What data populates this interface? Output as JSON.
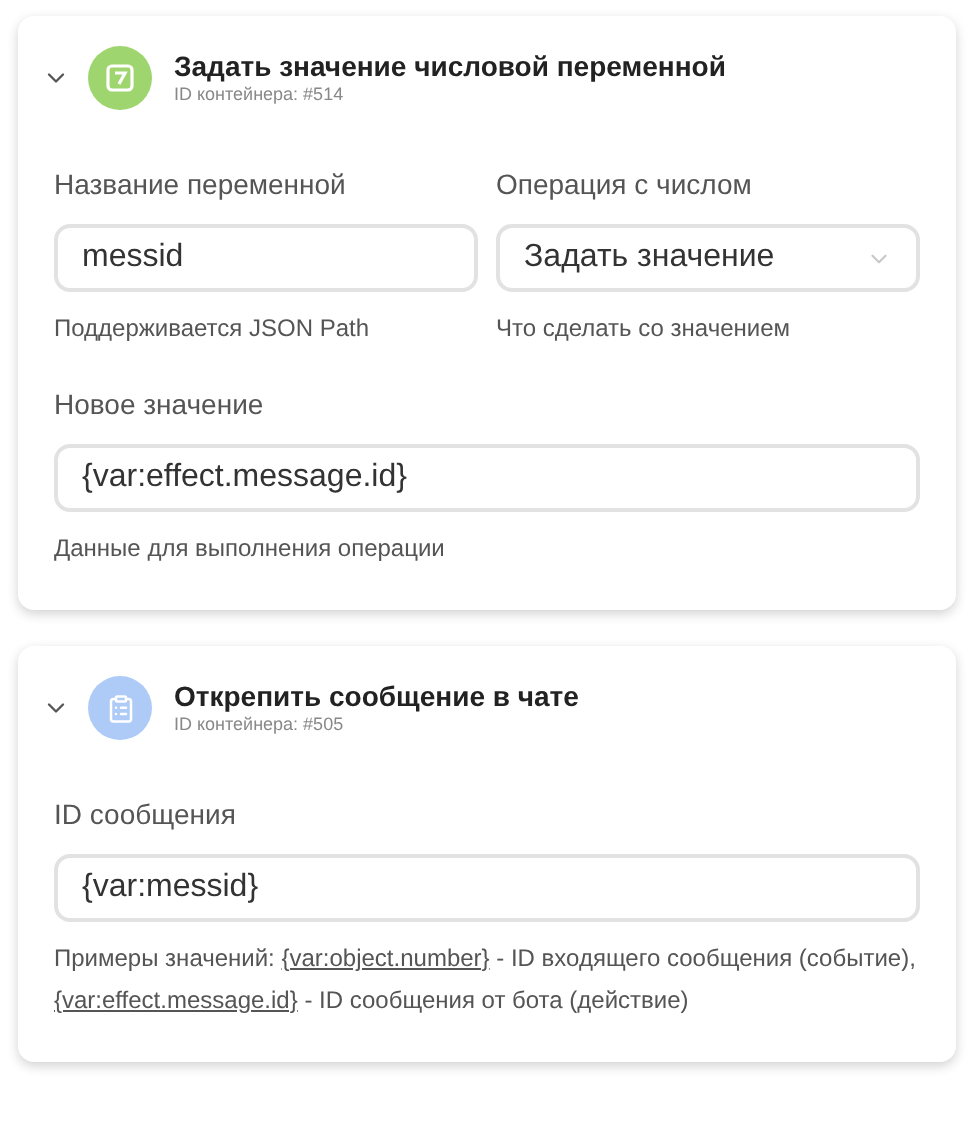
{
  "cards": [
    {
      "kind": "number",
      "color": "#9fd56e",
      "title": "Задать значение числовой переменной",
      "container_id": "ID контейнера: #514",
      "expanded": true,
      "rows": [
        [
          {
            "kind": "input",
            "label": "Название переменной",
            "value": "messid",
            "help": [
              {
                "kind": "text",
                "text": "Поддерживается JSON Path"
              }
            ]
          },
          {
            "kind": "select",
            "label": "Операция с числом",
            "value": "Задать значение",
            "help": [
              {
                "kind": "text",
                "text": "Что сделать со значением"
              }
            ]
          }
        ],
        [
          {
            "kind": "input",
            "label": "Новое значение",
            "value": "{var:effect.message.id}",
            "help": [
              {
                "kind": "text",
                "text": "Данные для выполнения операции"
              }
            ]
          }
        ]
      ]
    },
    {
      "kind": "clipboard",
      "color": "#aecbf7",
      "title": "Открепить сообщение в чате",
      "container_id": "ID контейнера: #505",
      "expanded": true,
      "rows": [
        [
          {
            "kind": "input",
            "label": "ID сообщения",
            "value": "{var:messid}",
            "help": [
              {
                "kind": "text",
                "text": "Примеры значений: "
              },
              {
                "kind": "link",
                "text": "{var:object.number}"
              },
              {
                "kind": "text",
                "text": " - ID входящего сообщения (событие), "
              },
              {
                "kind": "link",
                "text": "{var:effect.message.id}"
              },
              {
                "kind": "text",
                "text": " - ID сообщения от бота (действие)"
              }
            ]
          }
        ]
      ]
    }
  ]
}
